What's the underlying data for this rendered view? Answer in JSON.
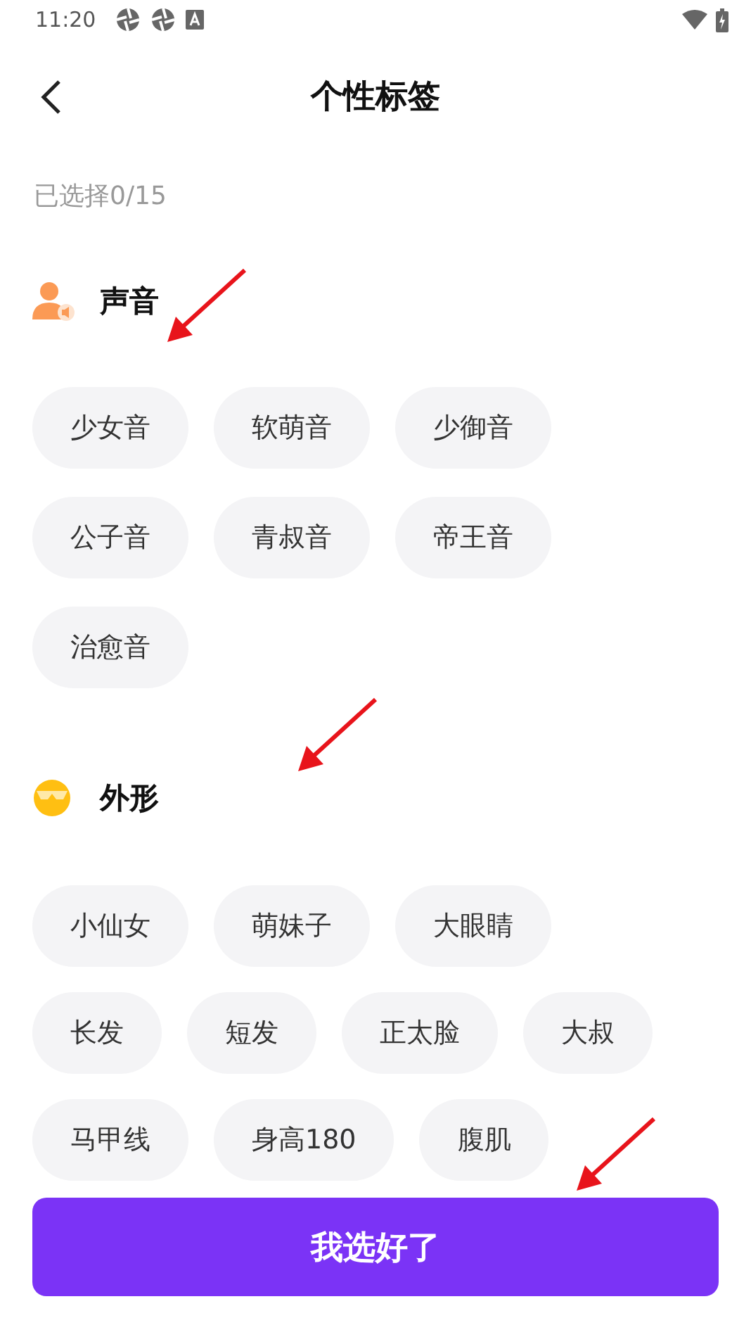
{
  "status_bar": {
    "time": "11:20"
  },
  "header": {
    "title": "个性标签"
  },
  "selection_count": "已选择0/15",
  "sections": [
    {
      "kind": "voice",
      "title": "声音",
      "annotated": true,
      "tags": [
        {
          "label": "少女音",
          "selected": false
        },
        {
          "label": "软萌音",
          "selected": false
        },
        {
          "label": "少御音",
          "selected": false
        },
        {
          "label": "公子音",
          "selected": false
        },
        {
          "label": "青叔音",
          "selected": false
        },
        {
          "label": "帝王音",
          "selected": false
        },
        {
          "label": "治愈音",
          "selected": false
        }
      ]
    },
    {
      "kind": "looks",
      "title": "外形",
      "annotated": true,
      "tags": [
        {
          "label": "小仙女",
          "selected": false
        },
        {
          "label": "萌妹子",
          "selected": false
        },
        {
          "label": "大眼睛",
          "selected": false
        },
        {
          "label": "长发",
          "selected": false
        },
        {
          "label": "短发",
          "selected": false
        },
        {
          "label": "正太脸",
          "selected": false
        },
        {
          "label": "大叔",
          "selected": false
        },
        {
          "label": "马甲线",
          "selected": false
        },
        {
          "label": "身高180",
          "selected": false
        },
        {
          "label": "腹肌",
          "selected": false
        }
      ]
    }
  ],
  "confirm_button": {
    "label": "我选好了",
    "annotated": true
  }
}
